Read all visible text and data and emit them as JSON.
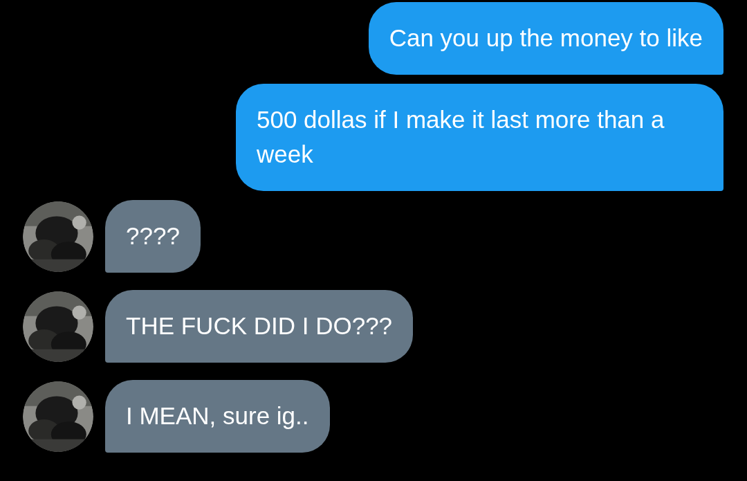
{
  "messages": [
    {
      "kind": "sent",
      "text": "Can you up the money to like"
    },
    {
      "kind": "sent",
      "text": "500 dollas if I make it last more than a week"
    },
    {
      "kind": "received",
      "text": "????"
    },
    {
      "kind": "received",
      "text": "THE FUCK DID I DO???"
    },
    {
      "kind": "received",
      "text": "I MEAN, sure ig.."
    }
  ]
}
